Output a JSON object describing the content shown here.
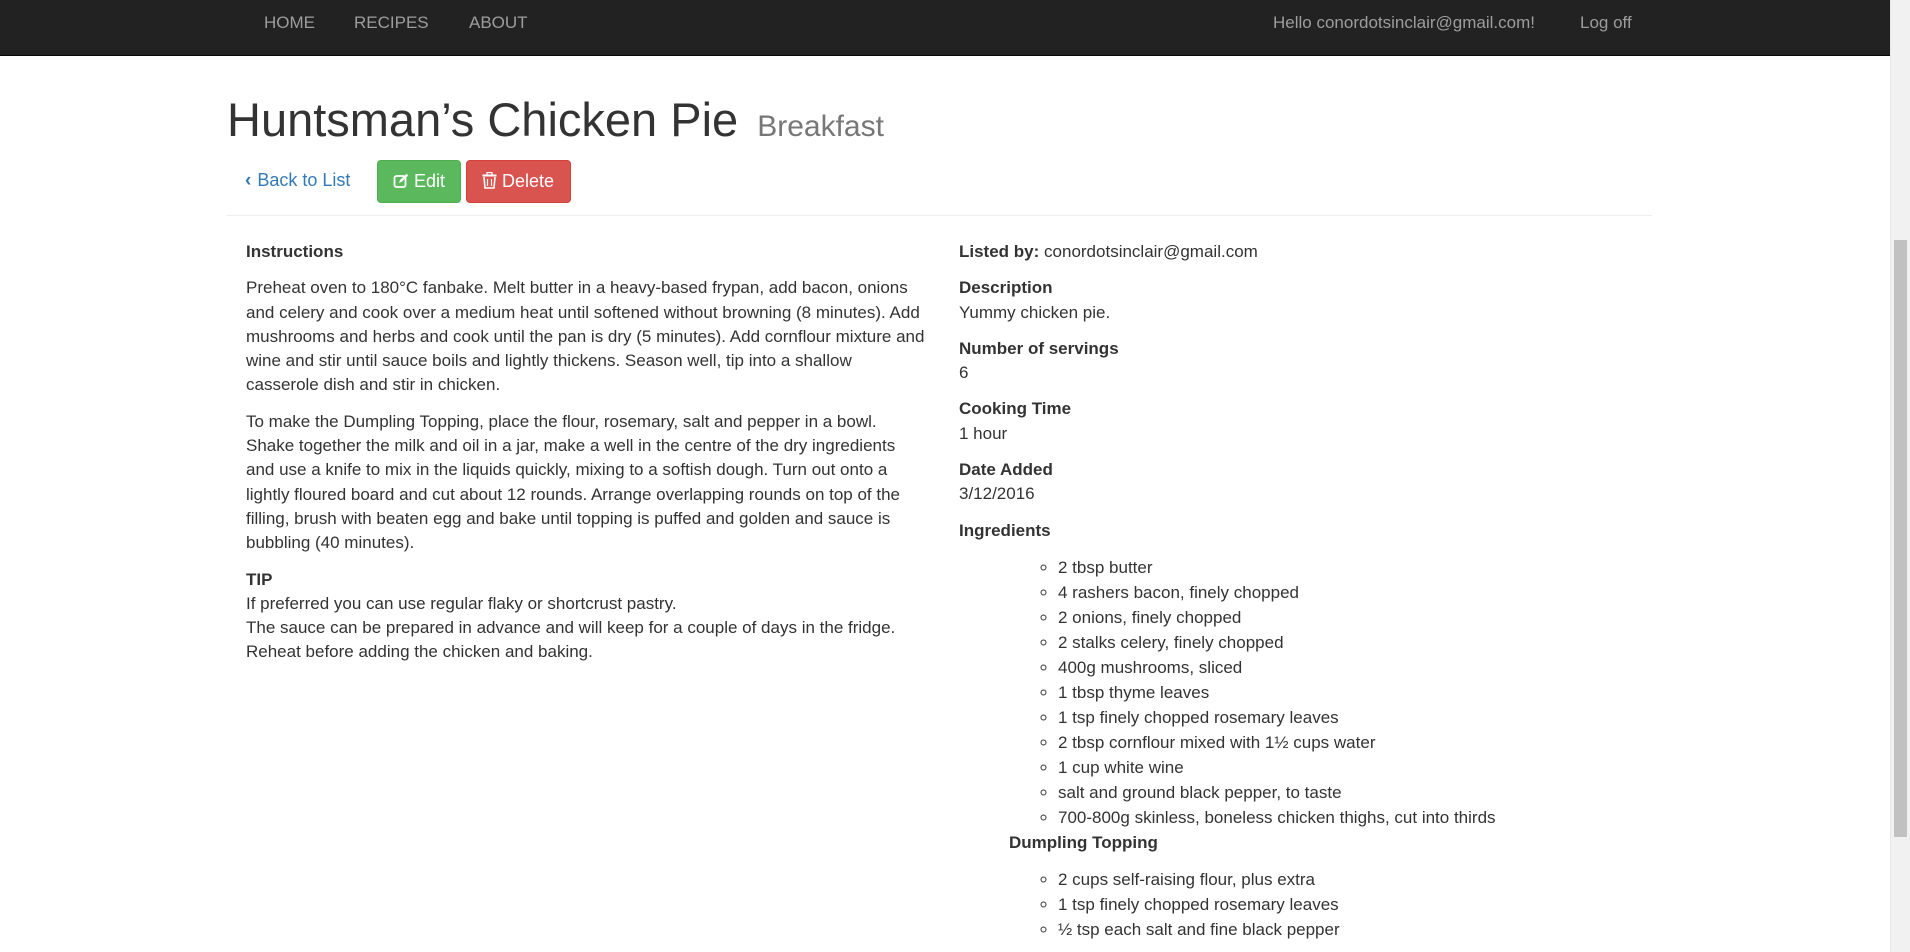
{
  "nav": {
    "home": "HOME",
    "recipes": "RECIPES",
    "about": "ABOUT",
    "greeting": "Hello conordotsinclair@gmail.com!",
    "logoff": "Log off"
  },
  "recipe": {
    "title": "Huntsman’s Chicken Pie",
    "category": "Breakfast"
  },
  "actions": {
    "back": "Back to List",
    "edit": "Edit",
    "delete": "Delete"
  },
  "instructions": {
    "heading": "Instructions",
    "paragraphs": [
      "Preheat oven to 180°C fanbake. Melt butter in a heavy-based frypan, add bacon, onions and celery and cook over a medium heat until softened without browning (8 minutes). Add mushrooms and herbs and cook until the pan is dry (5 minutes). Add cornflour mixture and wine and stir until sauce boils and lightly thickens. Season well, tip into a shallow casserole dish and stir in chicken.",
      "To make the Dumpling Topping, place the flour, rosemary, salt and pepper in a bowl. Shake together the milk and oil in a jar, make a well in the centre of the dry ingredients and use a knife to mix in the liquids quickly, mixing to a softish dough. Turn out onto a lightly floured board and cut about 12 rounds. Arrange overlapping rounds on top of the filling, brush with beaten egg and bake until topping is puffed and golden and sauce is bubbling (40 minutes)."
    ],
    "tip_heading": "TIP",
    "tip_lines": [
      "If preferred you can use regular flaky or shortcrust pastry.",
      "The sauce can be prepared in advance and will keep for a couple of days in the fridge.",
      "Reheat before adding the chicken and baking."
    ]
  },
  "details": {
    "listed_by_label": "Listed by:",
    "listed_by_value": "conordotsinclair@gmail.com",
    "description_label": "Description",
    "description_value": "Yummy chicken pie.",
    "servings_label": "Number of servings",
    "servings_value": "6",
    "time_label": "Cooking Time",
    "time_value": "1 hour",
    "date_label": "Date Added",
    "date_value": "3/12/2016",
    "ingredients_label": "Ingredients"
  },
  "ingredients": [
    "2 tbsp butter",
    "4 rashers bacon, finely chopped",
    "2 onions, finely chopped",
    "2 stalks celery, finely chopped",
    "400g mushrooms, sliced",
    "1 tbsp thyme leaves",
    "1 tsp finely chopped rosemary leaves",
    "2 tbsp cornflour mixed with 1½ cups water",
    "1 cup white wine",
    "salt and ground black pepper, to taste",
    "700-800g skinless, boneless chicken thighs, cut into thirds"
  ],
  "dumpling": {
    "heading": "Dumpling Topping",
    "items": [
      "2 cups self-raising flour, plus extra",
      "1 tsp finely chopped rosemary leaves",
      "½ tsp each salt and fine black pepper"
    ]
  },
  "colors": {
    "navbar_bg": "#222222",
    "nav_text": "#9d9d9d",
    "link": "#337ab7",
    "success": "#5cb85c",
    "danger": "#d9534f"
  }
}
